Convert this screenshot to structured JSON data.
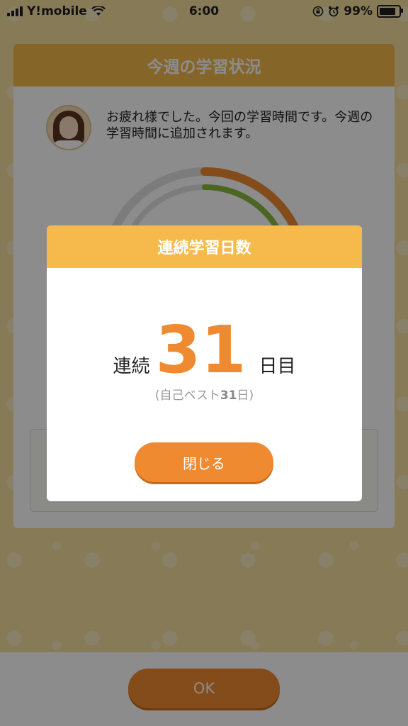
{
  "status_bar": {
    "carrier": "Y!mobile",
    "time": "6:00",
    "battery_percent_label": "99%",
    "battery_level": 0.99
  },
  "card": {
    "title": "今週の学習状況",
    "message": "お疲れ様でした。今回の学習時間です。今週の学習時間に追加されます。"
  },
  "modal": {
    "title": "連続学習日数",
    "streak_prefix": "連続",
    "streak_value": "31",
    "streak_suffix": "日目",
    "best_open": "(自己ベスト",
    "best_value": "31",
    "best_close": "日)",
    "close_label": "閉じる"
  },
  "bottom": {
    "ok_label": "OK"
  },
  "colors": {
    "accent": "#f08a30",
    "header": "#f5b94c",
    "background": "#f6df9f"
  }
}
